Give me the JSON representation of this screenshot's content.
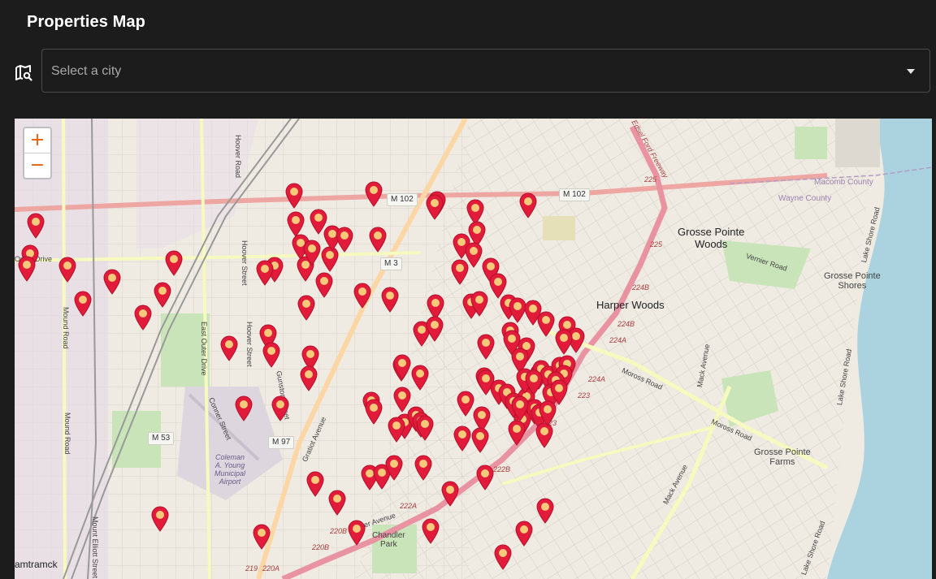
{
  "header": {
    "title": "Properties Map"
  },
  "filter": {
    "icon": "map-search-icon",
    "placeholder": "Select a city"
  },
  "map": {
    "zoom_in_label": "+",
    "zoom_out_label": "−",
    "marker_color": "#e31b3a",
    "marker_dot_color": "#f7c97a",
    "labels": {
      "grosse_pointe_woods": "Grosse Pointe\nWoods",
      "harper_woods": "Harper Woods",
      "grosse_pointe_shores": "Grosse Pointe\nShores",
      "grosse_pointe_farms": "Grosse Pointe\nFarms",
      "macomb_county": "Macomb County",
      "wayne_county": "Wayne County",
      "hamtramck": "amtramck",
      "chandler_park": "Chandler\nPark",
      "coleman_airport": "Coleman\nA. Young\nMunicipal\nAirport",
      "m102_a": "M 102",
      "m102_b": "M 102",
      "m3": "M 3",
      "m53": "M 53",
      "m97": "M 97",
      "i94_a": "225",
      "i94_b": "225",
      "i94_c": "224B",
      "i94_d": "224B",
      "i94_e": "224A",
      "i94_f": "224A",
      "i94_g": "223",
      "i94_h": "223",
      "i94_i": "222B",
      "i94_j": "222A",
      "i94_k": "220B",
      "i94_l": "220B",
      "i94_m": "220A",
      "i94_n": "219",
      "moross": "Moross Road",
      "vernier": "Vernier Road",
      "mack": "Mack Avenue",
      "harper": "Harper Avenue",
      "gratiot": "Gratiot Avenue",
      "outer_drive": "Outer Drive",
      "hoover1": "Hoover Road",
      "hoover2": "Hoover Street",
      "hoover3": "Hoover Street",
      "gunston": "Gunston Street",
      "east_outer": "East Outer Drive",
      "conner": "Conner Street",
      "mound1": "Mound Road",
      "mound2": "Mound Road",
      "mt_elliott": "Mount Elliott Street",
      "edsel": "Edsel Ford Freeway",
      "lake_shore1": "Lake Shore Road",
      "lake_shore2": "Lake Shore Road",
      "lake_shore3": "Lake Shore Road"
    }
  }
}
